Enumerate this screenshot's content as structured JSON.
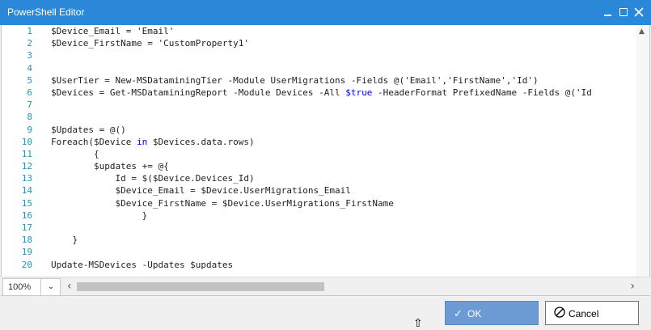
{
  "window": {
    "title": "PowerShell Editor",
    "accent_color": "#2b88d8",
    "controls": [
      "minimize-icon",
      "maximize-icon",
      "close-icon"
    ]
  },
  "editor": {
    "line_numbers": [
      "1",
      "2",
      "3",
      "4",
      "5",
      "6",
      "7",
      "8",
      "9",
      "10",
      "11",
      "12",
      "13",
      "14",
      "15",
      "16",
      "17",
      "18",
      "19",
      "20"
    ],
    "lines": [
      "$Device_Email = 'Email'",
      "$Device_FirstName = 'CustomProperty1'",
      "",
      "",
      "$UserTier = New-MSDataminingTier -Module UserMigrations -Fields @('Email','FirstName','Id')",
      "$Devices = Get-MSDataminingReport -Module Devices -All $true -HeaderFormat PrefixedName -Fields @('Id",
      "",
      "",
      "$Updates = @()",
      "Foreach($Device in $Devices.data.rows)",
      "        {",
      "        $updates += @{",
      "            Id = $($Device.Devices_Id)",
      "            $Device_Email = $Device.UserMigrations_Email",
      "            $Device_FirstName = $Device.UserMigrations_FirstName",
      "                 }",
      "",
      "    }",
      "",
      "Update-MSDevices -Updates $updates"
    ],
    "keyword_color": "#0000ff",
    "line_number_color": "#2b91af"
  },
  "statusbar": {
    "zoom_value": "100%"
  },
  "buttons": {
    "ok_label": "OK",
    "cancel_label": "Cancel"
  }
}
